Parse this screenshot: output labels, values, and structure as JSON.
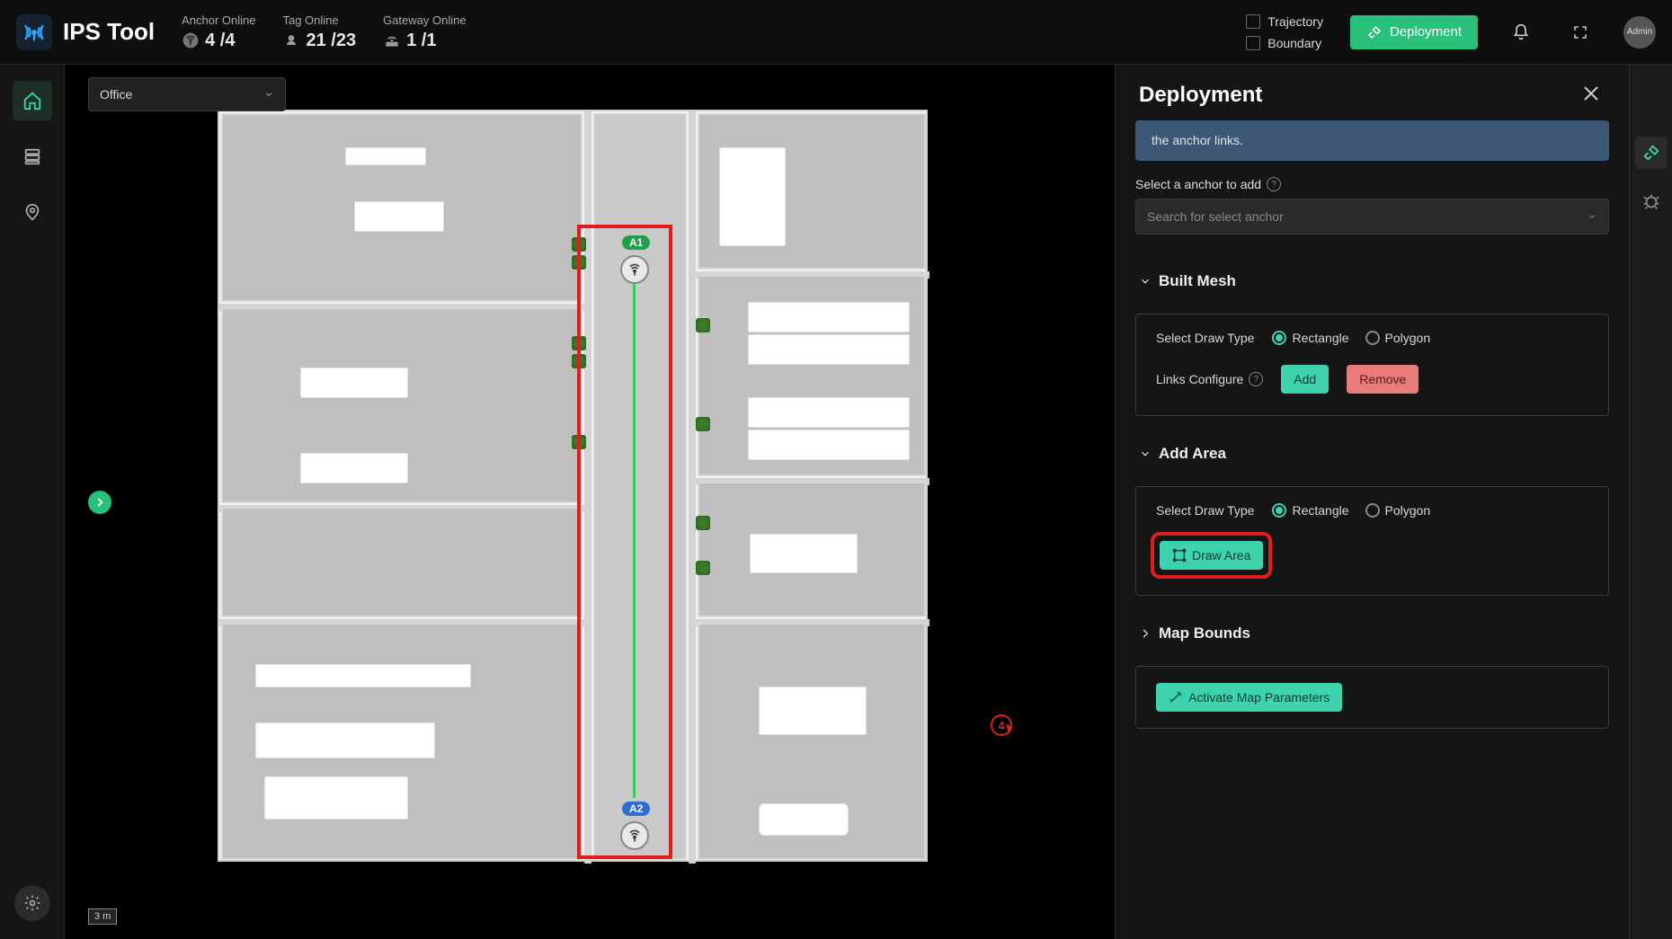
{
  "app": {
    "title": "IPS Tool"
  },
  "header": {
    "stats": {
      "anchor": {
        "label": "Anchor Online",
        "value": "4 /4"
      },
      "tag": {
        "label": "Tag Online",
        "value": "21 /23"
      },
      "gateway": {
        "label": "Gateway Online",
        "value": "1 /1"
      }
    },
    "toggles": {
      "trajectory": "Trajectory",
      "boundary": "Boundary"
    },
    "deploy_btn": "Deployment",
    "avatar": "Admin"
  },
  "map": {
    "select_value": "Office",
    "scale": "3 m",
    "anchors": {
      "a1": "A1",
      "a2": "A2"
    }
  },
  "panel": {
    "title": "Deployment",
    "info_tail": "the anchor links.",
    "anchor_select": {
      "label": "Select a anchor to add",
      "placeholder": "Search for select anchor"
    },
    "sections": {
      "built_mesh": {
        "title": "Built Mesh",
        "draw_type_label": "Select Draw Type",
        "radio_rect": "Rectangle",
        "radio_poly": "Polygon",
        "links_label": "Links Configure",
        "add_btn": "Add",
        "remove_btn": "Remove"
      },
      "add_area": {
        "title": "Add Area",
        "draw_type_label": "Select Draw Type",
        "radio_rect": "Rectangle",
        "radio_poly": "Polygon",
        "draw_btn": "Draw Area"
      },
      "map_bounds": {
        "title": "Map Bounds"
      },
      "activate_btn": "Activate Map Parameters"
    }
  },
  "annotation": {
    "step": "4"
  }
}
